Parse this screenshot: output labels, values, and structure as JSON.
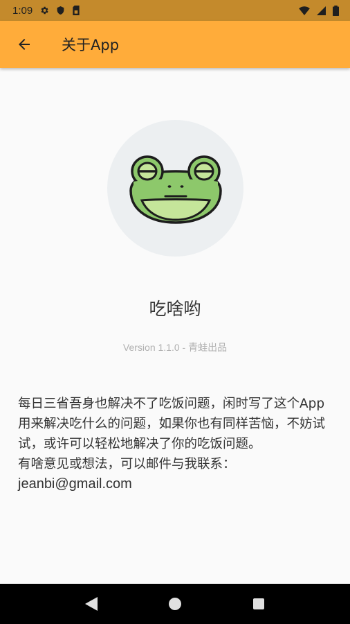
{
  "status_bar": {
    "time": "1:09",
    "icons_left": [
      "gear-icon",
      "shield-icon",
      "sim-card-icon"
    ],
    "icons_right": [
      "wifi-icon",
      "signal-icon",
      "battery-icon"
    ],
    "bg_color": "#c48a2c"
  },
  "app_bar": {
    "title": "关于App",
    "back_icon": "arrow-left-icon",
    "bg_color": "#ffac3a"
  },
  "about": {
    "logo": "frog-face-logo",
    "app_name": "吃啥哟",
    "version": "Version 1.1.0 - 青蛙出品",
    "description": "每日三省吾身也解决不了吃饭问题，闲时写了这个App用来解决吃什么的问题，如果你也有同样苦恼，不妨试试，或许可以轻松地解决了你的吃饭问题。\n有啥意见或想法，可以邮件与我联系：",
    "email": "jeanbi@gmail.com"
  },
  "nav_bar": {
    "buttons": [
      "back-triangle-icon",
      "home-circle-icon",
      "recents-square-icon"
    ]
  }
}
